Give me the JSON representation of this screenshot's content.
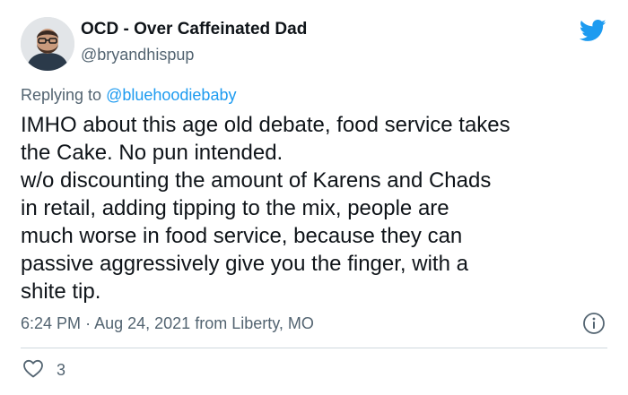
{
  "author": {
    "display_name": "OCD - Over Caffeinated Dad",
    "handle": "@bryandhispup"
  },
  "reply": {
    "prefix": "Replying to",
    "mention": "@bluehoodiebaby"
  },
  "tweet_text": {
    "lines": [
      "IMHO about this age old debate, food service takes",
      "the Cake. No pun intended.",
      "w/o discounting the amount of Karens and Chads",
      "in retail, adding tipping to the mix, people are",
      "much worse in food service, because they can",
      "passive aggressively give you the finger, with a",
      "shite tip."
    ]
  },
  "meta": {
    "time": "6:24 PM",
    "separator": "·",
    "date": "Aug 24, 2021",
    "location": "from Liberty, MO"
  },
  "actions": {
    "like_count": "3"
  },
  "icons": {
    "brand": "twitter-bird-icon",
    "info": "info-icon",
    "like": "heart-icon"
  },
  "colors": {
    "accent": "#1d9bf0",
    "secondary_text": "#536471",
    "primary_text": "#0f1419"
  }
}
